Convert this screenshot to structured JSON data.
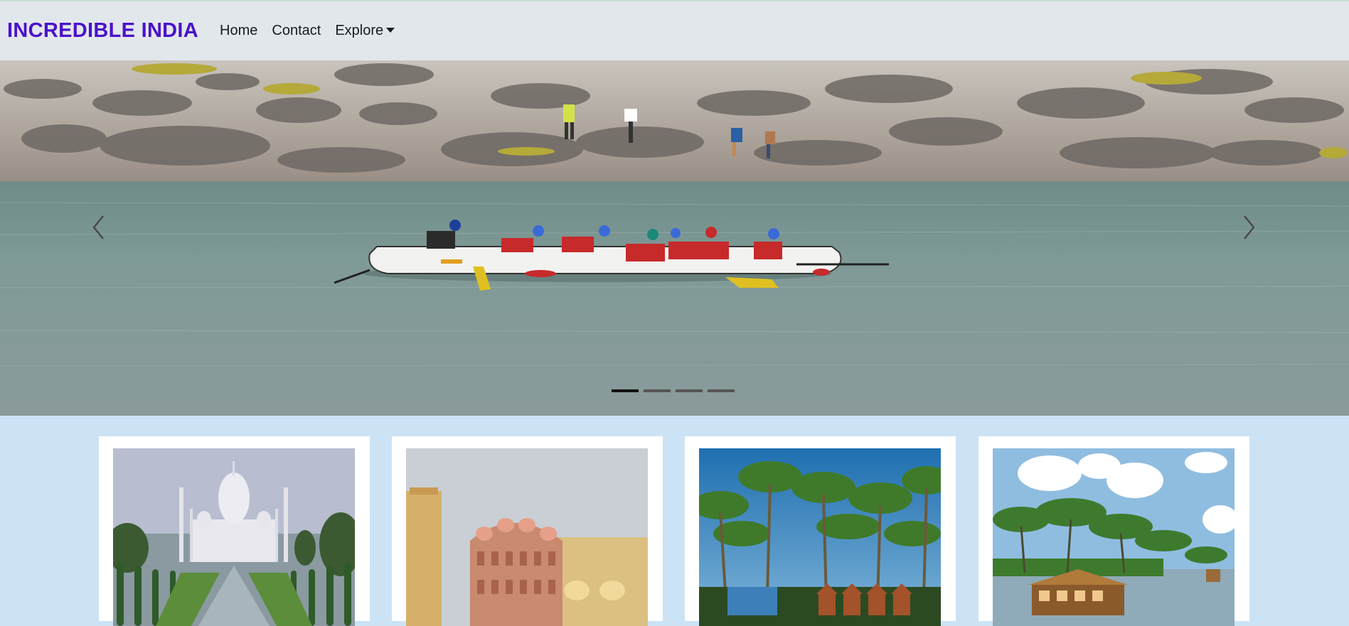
{
  "navbar": {
    "brand": "INCREDIBLE INDIA",
    "links": [
      {
        "label": "Home"
      },
      {
        "label": "Contact"
      },
      {
        "label": "Explore"
      }
    ]
  },
  "carousel": {
    "slide_count": 4,
    "active_slide": 1,
    "prev_icon": "chevron-left-icon",
    "next_icon": "chevron-right-icon",
    "current_image": "river-rafting-photo"
  },
  "cards": [
    {
      "image": "taj-mahal-photo"
    },
    {
      "image": "hawa-mahal-photo"
    },
    {
      "image": "goa-palm-beach-photo"
    },
    {
      "image": "kerala-houseboat-photo"
    }
  ],
  "colors": {
    "brand": "#4b12c9",
    "navbar_bg": "#e2e7ec",
    "page_bg": "#cce3f6"
  }
}
